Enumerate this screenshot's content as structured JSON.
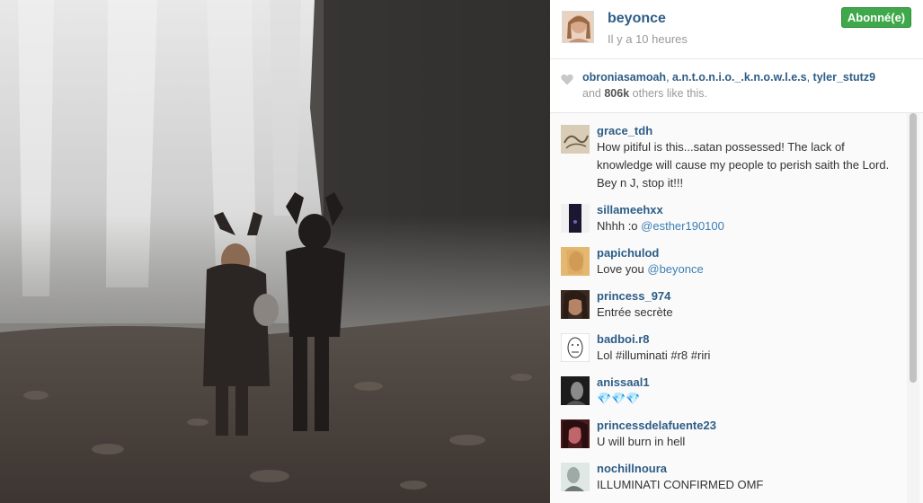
{
  "post": {
    "username": "beyonce",
    "time": "Il y a 10 heures",
    "follow_label": "Abonné(e)"
  },
  "likes": {
    "likers": [
      "obroniasamoah",
      "a.n.t.o.n.i.o._.k.n.o.w.l.e.s",
      "tyler_stutz9"
    ],
    "and_text": "and",
    "count": "806k",
    "suffix": "others like this."
  },
  "comments": [
    {
      "user": "grace_tdh",
      "text": "How pitiful is this...satan possessed! The lack of knowledge will cause my people to perish saith the Lord. Bey n J, stop it!!!"
    },
    {
      "user": "sillameehxx",
      "text": "Nhhh :o ",
      "mention": "@esther190100"
    },
    {
      "user": "papichulod",
      "text": "Love you ",
      "mention": "@beyonce"
    },
    {
      "user": "princess_974",
      "text": "Entrée secrète"
    },
    {
      "user": "badboi.r8",
      "text": "Lol #illuminati #r8 #riri"
    },
    {
      "user": "anissaal1",
      "text": "💎💎💎"
    },
    {
      "user": "princessdelafuente23",
      "text": "U will burn in hell"
    },
    {
      "user": "nochillnoura",
      "text": "ILLUMINATI CONFIRMED OMF"
    }
  ],
  "colors": {
    "link": "#2d5d86",
    "follow_green": "#3fa84b",
    "muted": "#9a9a9a"
  }
}
